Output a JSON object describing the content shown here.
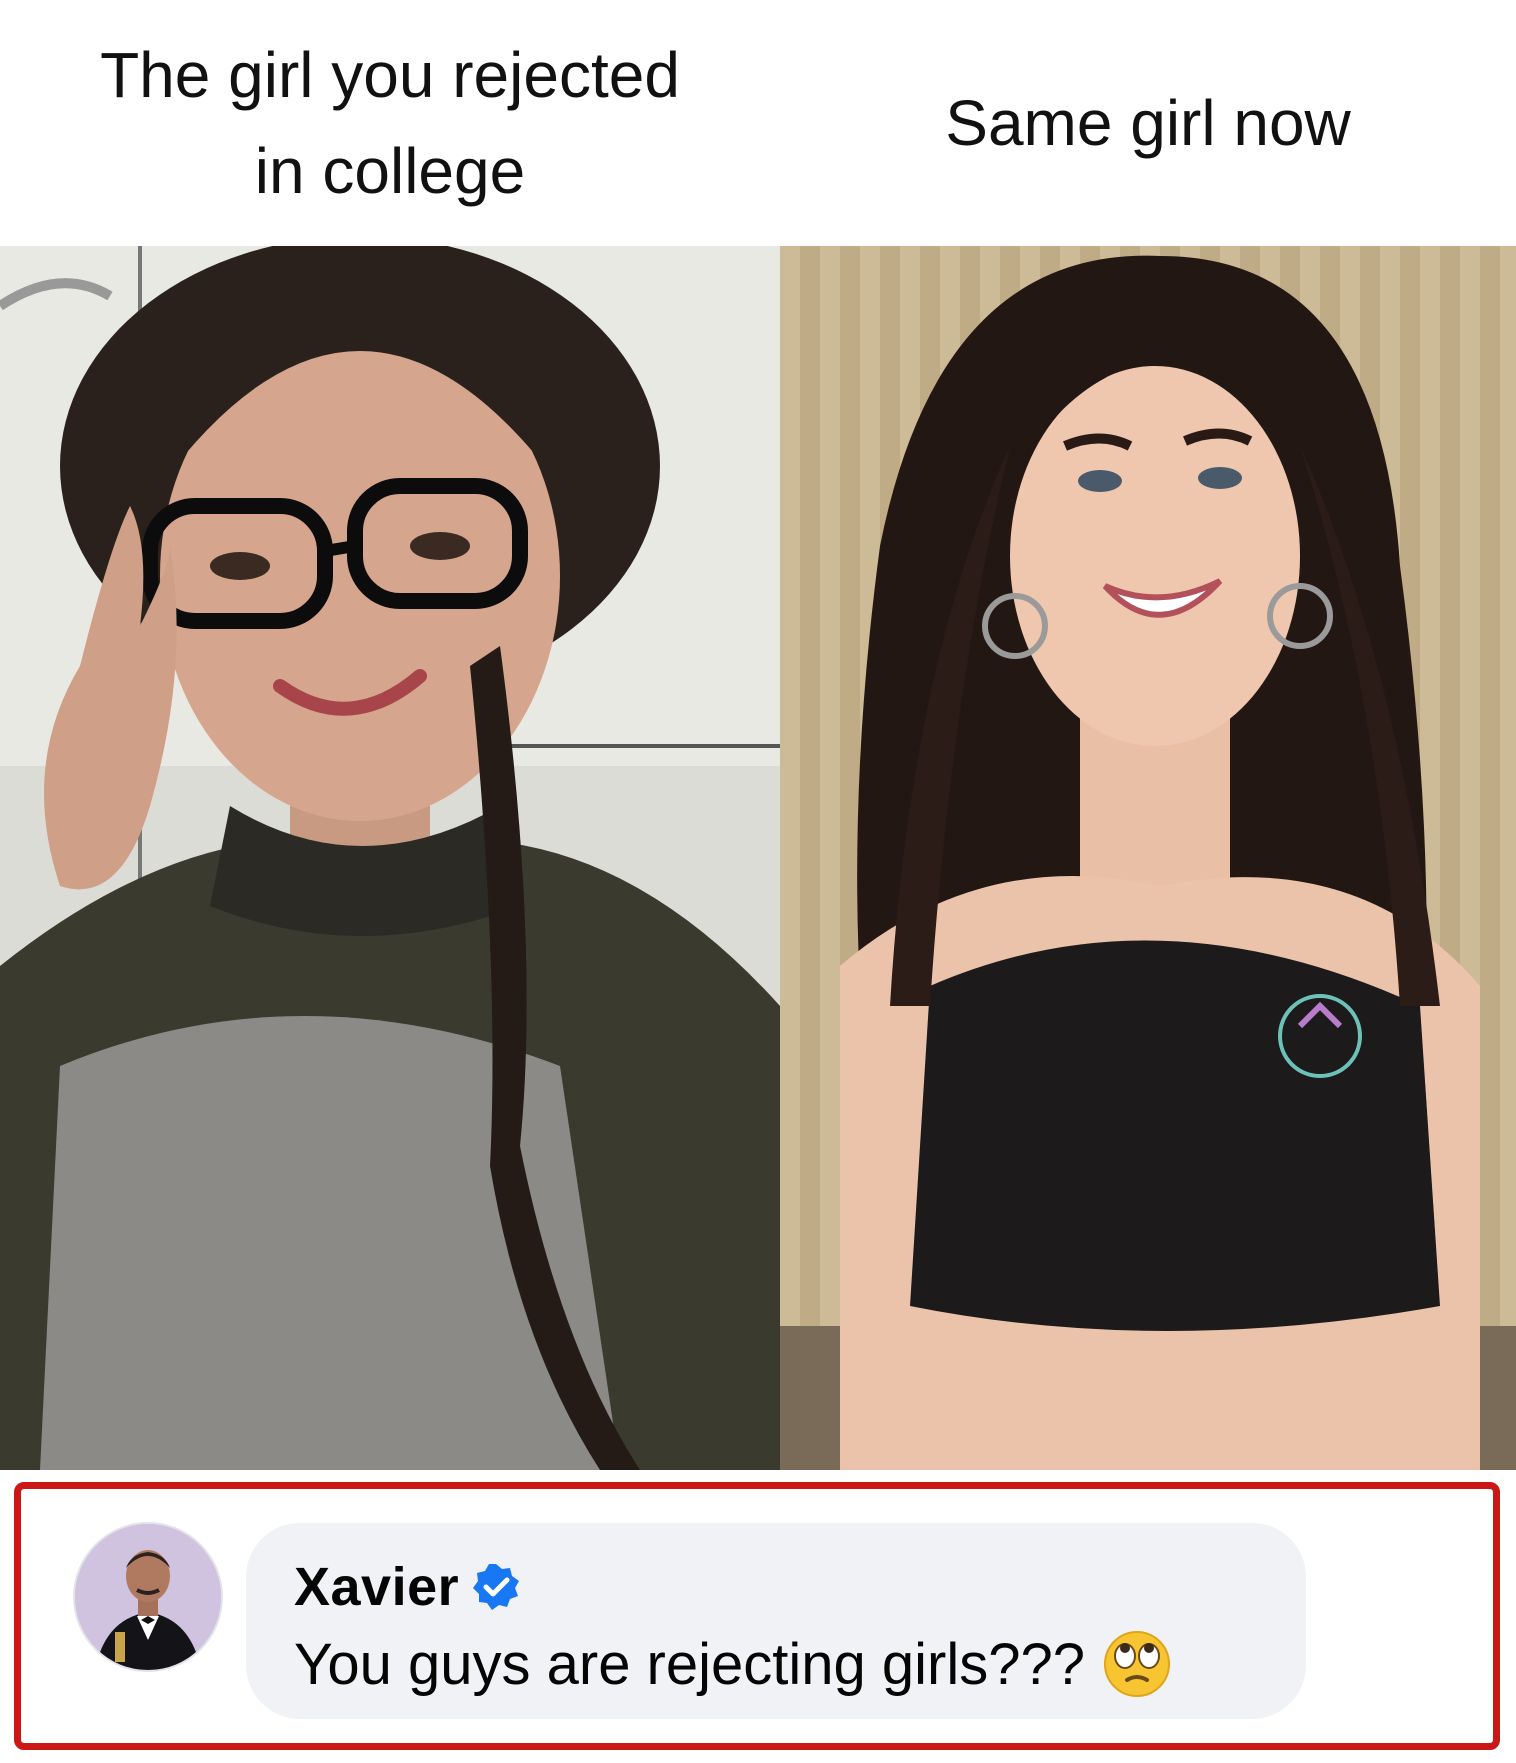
{
  "captions": {
    "left_line1": "The girl you rejected",
    "left_line2": "in college",
    "right": "Same girl now"
  },
  "photos": {
    "left": "photo of smiling girl with black glasses and braided hair",
    "right": "photo of smiling girl with long hair, hoop earrings and black crop top"
  },
  "comment": {
    "author": "Xavier",
    "verified_icon": "verified-badge-icon",
    "text": "You guys are rejecting girls???",
    "emoji_icon": "eye-roll-emoji-icon",
    "highlight_color": "#cc1717",
    "bubble_color": "#f0f2f5",
    "badge_color": "#1877f2"
  }
}
